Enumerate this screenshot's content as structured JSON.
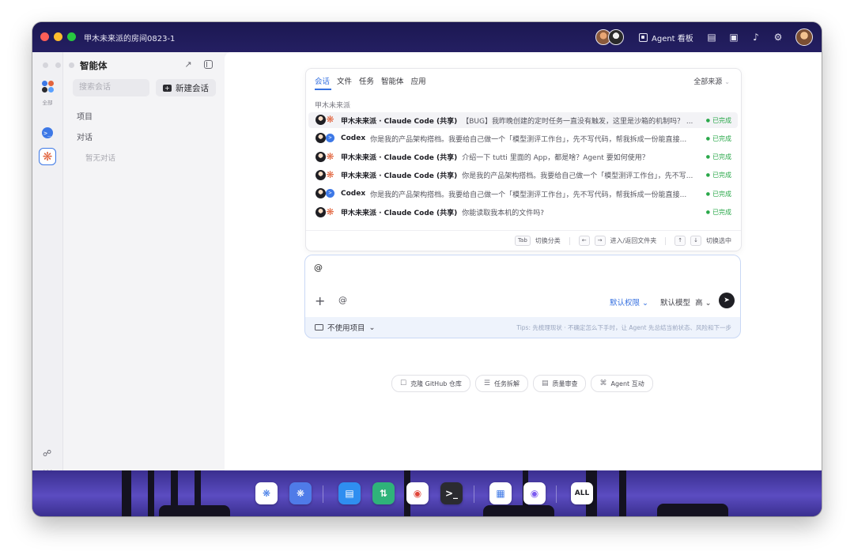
{
  "window": {
    "title": "甲木未来派的房间0823-1"
  },
  "topbar": {
    "agent_board_label": "Agent 看板",
    "icons": [
      "doc-icon",
      "screen-icon",
      "bell-icon",
      "settings-icon"
    ]
  },
  "rail": {
    "all_label": "全部"
  },
  "sidebar": {
    "title": "智能体",
    "search_placeholder": "搜索会话",
    "new_chat_label": "新建会话",
    "projects_label": "项目",
    "conversations_label": "对话",
    "empty_label": "暂无对话"
  },
  "dropdown": {
    "tabs": [
      {
        "label": "会话",
        "active": true
      },
      {
        "label": "文件",
        "active": false
      },
      {
        "label": "任务",
        "active": false
      },
      {
        "label": "智能体",
        "active": false
      },
      {
        "label": "应用",
        "active": false
      }
    ],
    "source_filter": "全部来源",
    "section_label": "甲木未来派",
    "rows": [
      {
        "agent": "claude",
        "name": "甲木未来派 · Claude Code (共享)",
        "message": "【BUG】我昨晚创建的定时任务一直没有触发，这里是沙箱的机制吗？ ...",
        "status": "已完成",
        "highlight": true
      },
      {
        "agent": "codex",
        "name": "Codex",
        "message": "你是我的产品架构搭档。我要给自己做一个「模型测评工作台」，先不写代码，帮我拆成一份能直接...",
        "status": "已完成",
        "highlight": false
      },
      {
        "agent": "claude",
        "name": "甲木未来派 · Claude Code (共享)",
        "message": "介绍一下 tutti 里面的 App，都是啥？Agent 要如何使用？",
        "status": "已完成",
        "highlight": false
      },
      {
        "agent": "claude",
        "name": "甲木未来派 · Claude Code (共享)",
        "message": "你是我的产品架构搭档。我要给自己做一个「模型测评工作台」，先不写...",
        "status": "已完成",
        "highlight": false
      },
      {
        "agent": "codex",
        "name": "Codex",
        "message": "你是我的产品架构搭档。我要给自己做一个「模型测评工作台」，先不写代码，帮我拆成一份能直接...",
        "status": "已完成",
        "highlight": false
      },
      {
        "agent": "claude",
        "name": "甲木未来派 · Claude Code (共享)",
        "message": "你能读取我本机的文件吗?",
        "status": "已完成",
        "highlight": false
      }
    ],
    "footer": {
      "tab_key": "Tab",
      "tab_hint": "切换分类",
      "lr_hint": "进入/返回文件夹",
      "ud_hint": "切换选中"
    }
  },
  "composer": {
    "text": "@",
    "permission_label": "默认权限",
    "model_label": "默认模型",
    "level_label": "高",
    "project_label": "不使用项目",
    "tips": "Tips: 先梳理现状 · 不确定怎么下手时，让 Agent 先总结当前状态、风险和下一步"
  },
  "chips": [
    {
      "icon": "github-icon",
      "label": "克隆 GitHub 仓库"
    },
    {
      "icon": "list-icon",
      "label": "任务拆解"
    },
    {
      "icon": "review-icon",
      "label": "质量审查"
    },
    {
      "icon": "agents-icon",
      "label": "Agent 互动"
    }
  ],
  "dock": {
    "all_label": "ALL"
  },
  "colors": {
    "accent": "#3570e0",
    "done": "#2aa84a",
    "window_bar": "#1c1852"
  }
}
